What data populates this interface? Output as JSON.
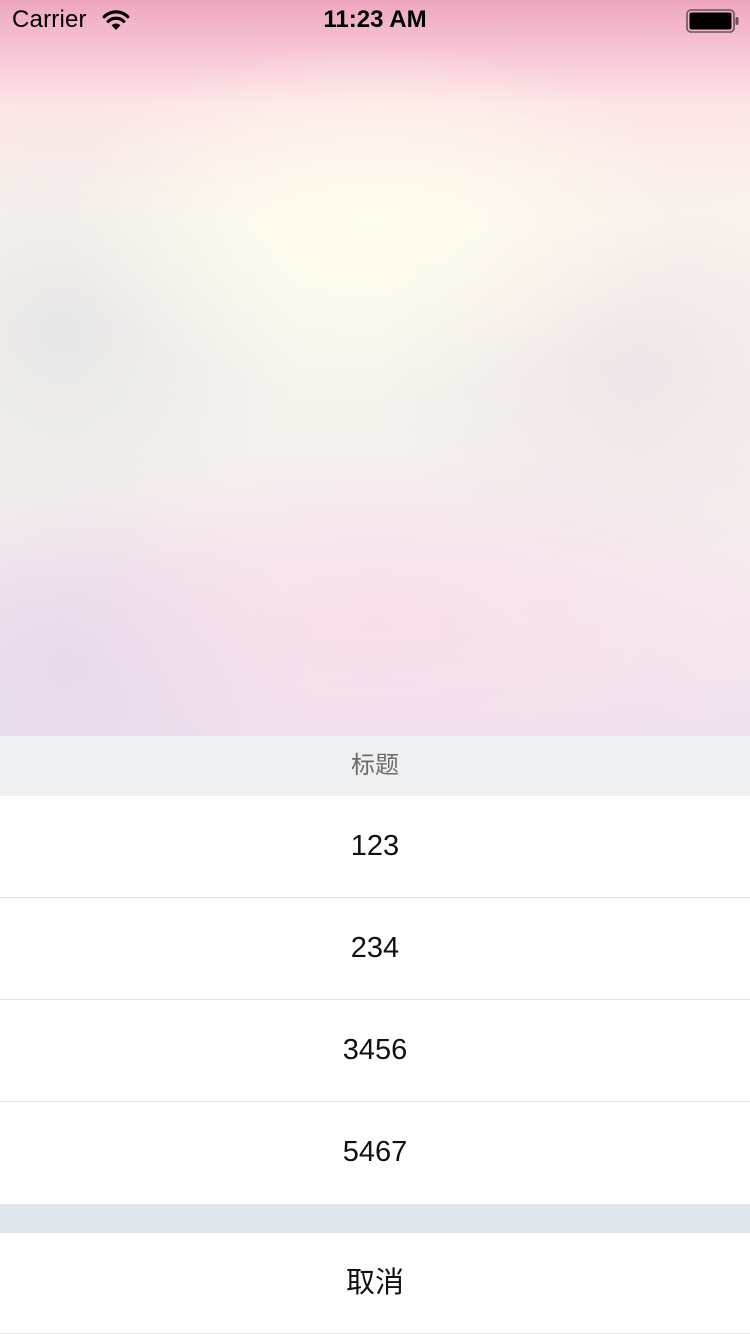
{
  "status_bar": {
    "carrier": "Carrier",
    "time": "11:23 AM",
    "wifi_icon": "wifi-icon",
    "battery_icon": "battery-icon"
  },
  "action_sheet": {
    "title": "标题",
    "options": [
      {
        "label": "123"
      },
      {
        "label": "234"
      },
      {
        "label": "3456"
      },
      {
        "label": "5467"
      }
    ],
    "cancel_label": "取消"
  },
  "colors": {
    "title_background": "#eff0f1",
    "title_text": "#6b6b6b",
    "option_background": "#ffffff",
    "separator": "#e4e4e4",
    "gap_background": "#e0e7ec"
  }
}
